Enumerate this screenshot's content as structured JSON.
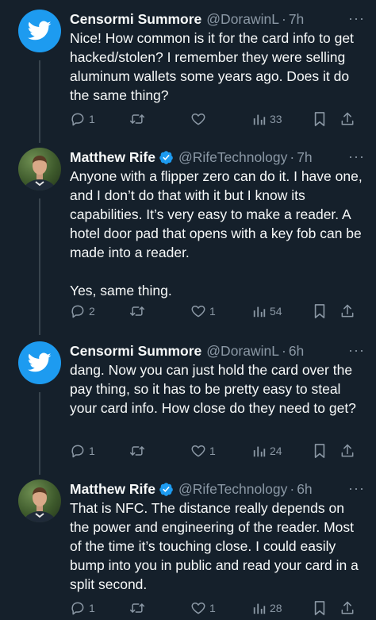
{
  "colors": {
    "background": "#15202b",
    "text": "#f7f9f9",
    "secondary": "#8b98a5",
    "accent": "#1d9bf0",
    "thread_line": "#38444d"
  },
  "tweets": [
    {
      "author": "Censormi Summore",
      "handle": "@DorawinL",
      "separator": "·",
      "time": "7h",
      "verified": false,
      "avatar": "default-bird-avatar",
      "text": "Nice! How common is it for the card info to get hacked/stolen? I remember they were selling aluminum wallets some years ago. Does it do the same thing?",
      "replies": "1",
      "retweets": "",
      "likes": "",
      "views": "33"
    },
    {
      "author": "Matthew Rife",
      "handle": "@RifeTechnology",
      "separator": "·",
      "time": "7h",
      "verified": true,
      "avatar": "profile-photo",
      "text": "Anyone with a flipper zero can do it.  I have one, and I don’t do that with it but I know its capabilities.  It’s very easy to make a reader.  A hotel door pad that opens with a key fob can be made into a reader.\n\nYes, same thing.",
      "replies": "2",
      "retweets": "",
      "likes": "1",
      "views": "54"
    },
    {
      "author": "Censormi Summore",
      "handle": "@DorawinL",
      "separator": "·",
      "time": "6h",
      "verified": false,
      "avatar": "default-bird-avatar",
      "text": "dang. Now you can just hold the card over the pay thing, so it has to be pretty easy to steal your card info. How close do they need to get?",
      "replies": "1",
      "retweets": "",
      "likes": "1",
      "views": "24"
    },
    {
      "author": "Matthew Rife",
      "handle": "@RifeTechnology",
      "separator": "·",
      "time": "6h",
      "verified": true,
      "avatar": "profile-photo",
      "text": "That is NFC.  The distance really depends on the power and engineering of the reader.  Most of the time it’s touching close.  I could easily bump into you in public and read your card in a split second.",
      "replies": "1",
      "retweets": "",
      "likes": "1",
      "views": "28"
    }
  ]
}
